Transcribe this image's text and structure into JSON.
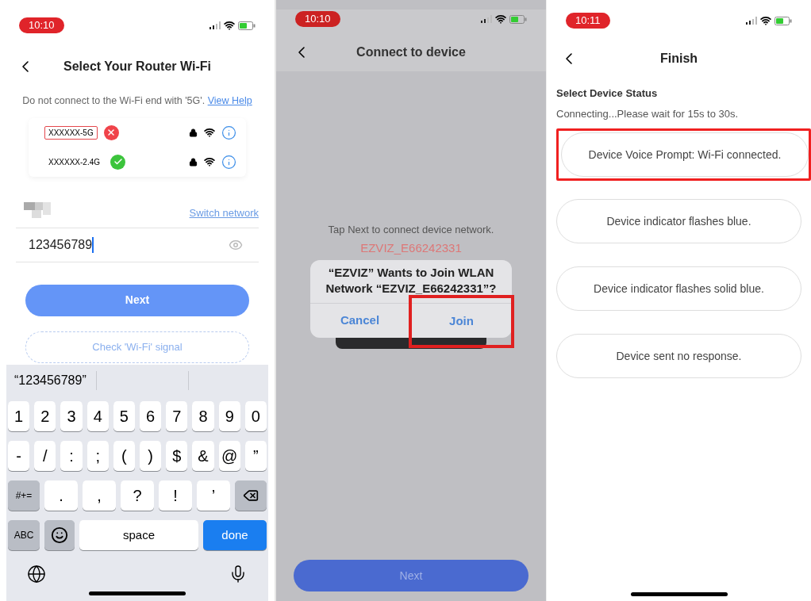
{
  "router_screen": {
    "status_time": "10:10",
    "title": "Select Your Router Wi-Fi",
    "notice": "Do not connect to the Wi-Fi end with '5G'.",
    "notice_link": "View Help",
    "networks": [
      {
        "name": "XXXXXX-5G",
        "compatible": false,
        "highlighted": true
      },
      {
        "name": "XXXXXX-2.4G",
        "compatible": true,
        "highlighted": false
      }
    ],
    "switch_link": "Switch network",
    "password": "123456789",
    "next_button": "Next",
    "check_button": "Check 'Wi-Fi' signal",
    "keyboard": {
      "suggestion": "“123456789”",
      "rows": [
        {
          "keys": [
            {
              "kind": "char",
              "label": "1"
            },
            {
              "kind": "char",
              "label": "2"
            },
            {
              "kind": "char",
              "label": "3"
            },
            {
              "kind": "char",
              "label": "4"
            },
            {
              "kind": "char",
              "label": "5"
            },
            {
              "kind": "char",
              "label": "6"
            },
            {
              "kind": "char",
              "label": "7"
            },
            {
              "kind": "char",
              "label": "8"
            },
            {
              "kind": "char",
              "label": "9"
            },
            {
              "kind": "char",
              "label": "0"
            }
          ]
        },
        {
          "keys": [
            {
              "kind": "char",
              "label": "-"
            },
            {
              "kind": "char",
              "label": "/"
            },
            {
              "kind": "char",
              "label": ":"
            },
            {
              "kind": "char",
              "label": ";"
            },
            {
              "kind": "char",
              "label": "("
            },
            {
              "kind": "char",
              "label": ")"
            },
            {
              "kind": "char",
              "label": "$"
            },
            {
              "kind": "char",
              "label": "&"
            },
            {
              "kind": "char",
              "label": "@"
            },
            {
              "kind": "char",
              "label": "”"
            }
          ]
        },
        {
          "keys": [
            {
              "kind": "function",
              "label": "#+="
            },
            {
              "kind": "char",
              "label": "."
            },
            {
              "kind": "char",
              "label": ","
            },
            {
              "kind": "char",
              "label": "?"
            },
            {
              "kind": "char",
              "label": "!"
            },
            {
              "kind": "char",
              "label": "’"
            },
            {
              "kind": "backspace"
            }
          ]
        },
        {
          "keys": [
            {
              "kind": "function",
              "label": "ABC"
            },
            {
              "kind": "emoji"
            },
            {
              "kind": "space",
              "label": "space"
            },
            {
              "kind": "return",
              "label": "done"
            }
          ]
        }
      ]
    }
  },
  "connect_screen": {
    "status_time": "10:10",
    "title": "Connect to device",
    "instruction": "Tap Next to connect device network.",
    "device_network": "EZVIZ_E66242331",
    "dialog": {
      "message": "“EZVIZ” Wants to Join WLAN Network “EZVIZ_E66242331”?",
      "buttons": [
        {
          "label": "Cancel",
          "highlighted": false
        },
        {
          "label": "Join",
          "highlighted": true
        }
      ]
    },
    "next_button": "Next"
  },
  "finish_screen": {
    "status_time": "10:11",
    "title": "Finish",
    "heading": "Select Device Status",
    "subtitle": "Connecting...Please wait for 15s to 30s.",
    "options": [
      {
        "label": "Device Voice Prompt: Wi-Fi connected.",
        "highlighted": true
      },
      {
        "label": "Device indicator flashes blue.",
        "highlighted": false
      },
      {
        "label": "Device indicator flashes solid blue.",
        "highlighted": false
      },
      {
        "label": "Device sent no response.",
        "highlighted": false
      }
    ]
  }
}
